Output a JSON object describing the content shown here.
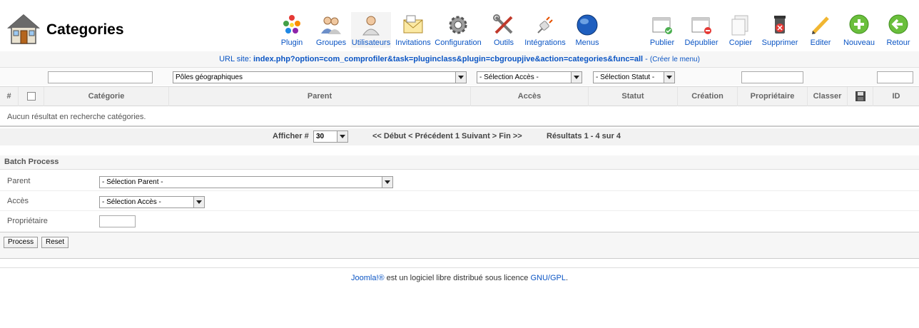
{
  "header": {
    "title": "Categories"
  },
  "toolbar": {
    "left": [
      {
        "label": "Plugin",
        "icon": "plugin-icon"
      },
      {
        "label": "Groupes",
        "icon": "groups-icon"
      },
      {
        "label": "Utilisateurs",
        "icon": "users-icon"
      },
      {
        "label": "Invitations",
        "icon": "invitations-icon"
      },
      {
        "label": "Configuration",
        "icon": "gear-icon"
      },
      {
        "label": "Outils",
        "icon": "tools-icon"
      },
      {
        "label": "Intégrations",
        "icon": "plug-icon"
      },
      {
        "label": "Menus",
        "icon": "globe-icon"
      }
    ],
    "right": [
      {
        "label": "Publier",
        "icon": "publish-icon"
      },
      {
        "label": "Dépublier",
        "icon": "unpublish-icon"
      },
      {
        "label": "Copier",
        "icon": "copy-icon"
      },
      {
        "label": "Supprimer",
        "icon": "delete-icon"
      },
      {
        "label": "Editer",
        "icon": "edit-icon"
      },
      {
        "label": "Nouveau",
        "icon": "new-icon"
      },
      {
        "label": "Retour",
        "icon": "back-icon"
      }
    ]
  },
  "url_bar": {
    "label": "URL site: ",
    "value": "index.php?option=com_comprofiler&task=pluginclass&plugin=cbgroupjive&action=categories&func=all",
    "separator": " - ",
    "create_menu": "(Créer le menu)"
  },
  "filters": {
    "search_value": "",
    "parent_select": "Pôles géographiques",
    "access_select": "- Sélection Accès -",
    "status_select": "- Sélection Statut -",
    "owner_value": "",
    "id_value": ""
  },
  "table": {
    "columns": [
      "#",
      "",
      "Catégorie",
      "Parent",
      "Accès",
      "Statut",
      "Création",
      "Propriétaire",
      "Classer",
      "",
      "ID"
    ],
    "empty_message": "Aucun résultat en recherche catégories."
  },
  "pager": {
    "show_label": "Afficher #",
    "show_value": "30",
    "nav": "<< Début < Précédent 1 Suivant > Fin >>",
    "results": "Résultats 1 - 4 sur 4"
  },
  "batch": {
    "title": "Batch Process",
    "rows": [
      {
        "label": "Parent",
        "value": "- Sélection Parent -"
      },
      {
        "label": "Accès",
        "value": "- Sélection Accès -"
      },
      {
        "label": "Propriétaire",
        "value": ""
      }
    ],
    "process_label": "Process",
    "reset_label": "Reset"
  },
  "footer": {
    "joomla_link": "Joomla!®",
    "text": " est un logiciel libre distribué sous licence ",
    "license_link": "GNU/GPL",
    "end": "."
  },
  "colors": {
    "link": "#0b55c4",
    "header_bg": "#f2f2f2"
  }
}
